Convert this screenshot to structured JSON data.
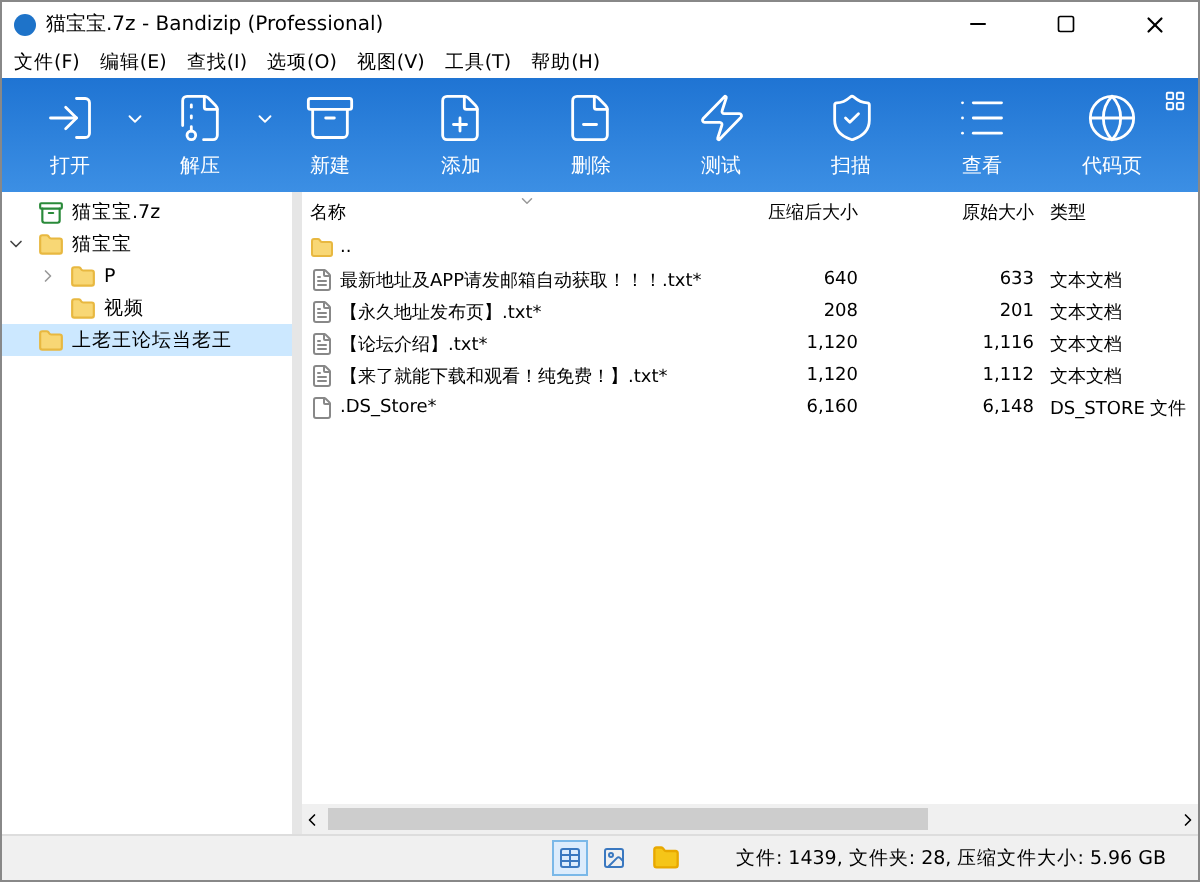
{
  "window": {
    "title": "猫宝宝.7z - Bandizip (Professional)"
  },
  "menu": [
    "文件(F)",
    "编辑(E)",
    "查找(I)",
    "选项(O)",
    "视图(V)",
    "工具(T)",
    "帮助(H)"
  ],
  "toolbar": [
    {
      "kind": "open",
      "label": "打开",
      "dropdown": true
    },
    {
      "kind": "extract",
      "label": "解压",
      "dropdown": true
    },
    {
      "kind": "new",
      "label": "新建",
      "dropdown": false
    },
    {
      "kind": "add",
      "label": "添加",
      "dropdown": false
    },
    {
      "kind": "delete",
      "label": "删除",
      "dropdown": false
    },
    {
      "kind": "test",
      "label": "测试",
      "dropdown": false
    },
    {
      "kind": "scan",
      "label": "扫描",
      "dropdown": false
    },
    {
      "kind": "view",
      "label": "查看",
      "dropdown": false
    },
    {
      "kind": "codepage",
      "label": "代码页",
      "dropdown": false
    }
  ],
  "tree": [
    {
      "kind": "archive",
      "label": "猫宝宝.7z",
      "selected": false
    },
    {
      "kind": "folder",
      "label": "猫宝宝",
      "selected": false,
      "expanded": true,
      "children": [
        {
          "kind": "folder",
          "label": "P",
          "selected": false,
          "expanded": false
        },
        {
          "kind": "folder",
          "label": "视频",
          "selected": false
        }
      ]
    },
    {
      "kind": "folder",
      "label": "上老王论坛当老王",
      "selected": true
    }
  ],
  "table": {
    "columns": [
      "名称",
      "压缩后大小",
      "原始大小",
      "类型"
    ],
    "rows": [
      {
        "kind": "folder",
        "name": ".."
      },
      {
        "kind": "text",
        "name": "最新地址及APP请发邮箱自动获取！！！.txt*",
        "packed": "640",
        "size": "633",
        "type": "文本文档"
      },
      {
        "kind": "text",
        "name": "【永久地址发布页】.txt*",
        "packed": "208",
        "size": "201",
        "type": "文本文档"
      },
      {
        "kind": "text",
        "name": "【论坛介绍】.txt*",
        "packed": "1,120",
        "size": "1,116",
        "type": "文本文档"
      },
      {
        "kind": "text",
        "name": "【来了就能下载和观看！纯免费！】.txt*",
        "packed": "1,120",
        "size": "1,112",
        "type": "文本文档"
      },
      {
        "kind": "file",
        "name": ".DS_Store*",
        "packed": "6,160",
        "size": "6,148",
        "type": "DS_STORE 文件"
      }
    ]
  },
  "status_bar": {
    "view_modes": [
      {
        "kind": "details",
        "selected": true
      },
      {
        "kind": "preview",
        "selected": false
      }
    ],
    "text": "文件: 1439, 文件夹: 28, 压缩文件大小: 5.96 GB"
  }
}
